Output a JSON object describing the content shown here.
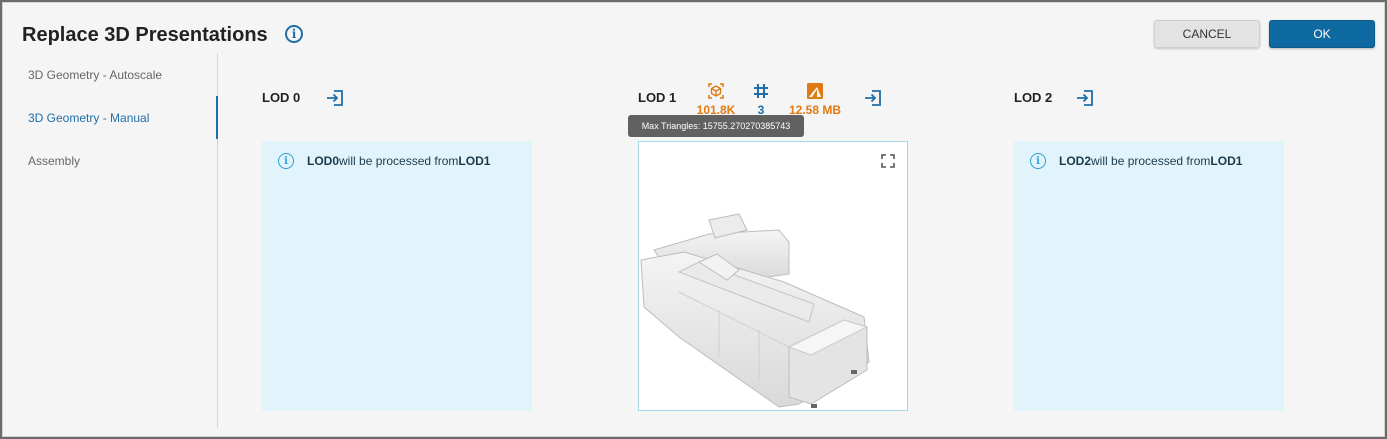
{
  "dialog": {
    "title": "Replace 3D Presentations",
    "cancel_label": "CANCEL",
    "ok_label": "OK"
  },
  "sidebar": {
    "items": [
      {
        "label": "3D Geometry - Autoscale",
        "active": false
      },
      {
        "label": "3D Geometry - Manual",
        "active": true
      },
      {
        "label": "Assembly",
        "active": false
      }
    ]
  },
  "lods": [
    {
      "label": "LOD 0",
      "message": {
        "lead": "LOD0",
        "mid": " will be processed from ",
        "tail": "LOD1"
      }
    },
    {
      "label": "LOD 1",
      "stats": {
        "triangles": "101.8K",
        "materials": "3",
        "size": "12.58 MB"
      },
      "tooltip": "Max Triangles: 15755.270270385743"
    },
    {
      "label": "LOD 2",
      "message": {
        "lead": "LOD2",
        "mid": " will be processed from ",
        "tail": "LOD1"
      }
    }
  ],
  "colors": {
    "accent": "#1f6ea8",
    "stat_orange": "#e07b13",
    "panel_bg": "#e2f4fb"
  }
}
